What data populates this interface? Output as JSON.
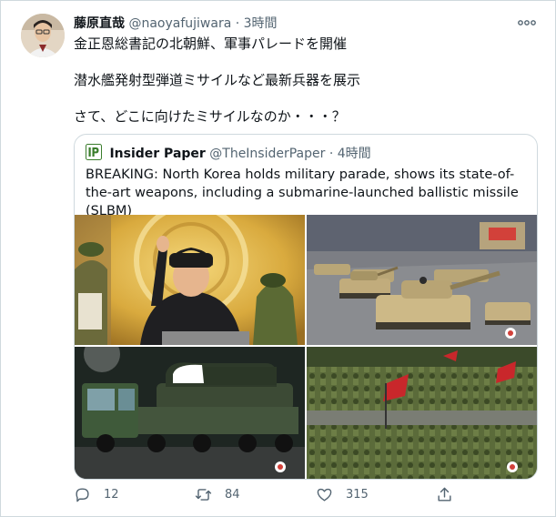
{
  "author": {
    "name": "藤原直哉",
    "handle": "@naoyafujiwara",
    "separator": "·",
    "time": "3時間"
  },
  "tweet": {
    "lines": [
      "金正恩総書記の北朝鮮、軍事パレードを開催",
      "潜水艦発射型弾道ミサイルなど最新兵器を展示",
      "さて、どこに向けたミサイルなのか・・・？"
    ]
  },
  "quote": {
    "name": "Insider Paper",
    "handle": "@TheInsiderPaper",
    "separator": "·",
    "time": "4時間",
    "text": "BREAKING: North Korea holds military parade, shows its state-of-the-art weapons, including a submarine-launched ballistic missile (SLBM)"
  },
  "stats": {
    "replies": "12",
    "retweets": "84",
    "likes": "315"
  },
  "icons": {
    "more": "more-horizontal-icon",
    "reply": "reply-icon",
    "retweet": "retweet-icon",
    "like": "like-icon",
    "share": "share-icon"
  },
  "colors": {
    "text": "#0f1419",
    "secondary": "#536471",
    "border": "#cfd9de",
    "insider_logo": "#3a7d2c"
  }
}
